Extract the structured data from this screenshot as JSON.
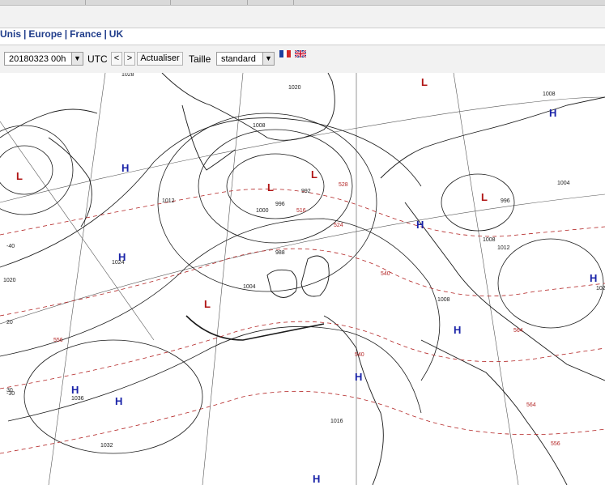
{
  "nav": {
    "links": [
      "Unis",
      "Europe",
      "France",
      "UK"
    ],
    "separator": "|"
  },
  "toolbar": {
    "date_value": "20180323 00h",
    "utc_label": "UTC",
    "prev_label": "<",
    "next_label": ">",
    "refresh_label": "Actualiser",
    "size_label": "Taille",
    "size_value": "standard"
  },
  "flags": [
    "french-flag",
    "uk-flag"
  ],
  "map": {
    "high_symbol": "H",
    "low_symbol": "L",
    "isobar_labels": [
      "1028",
      "1020",
      "1008",
      "1000",
      "996",
      "992",
      "988",
      "1012",
      "1004",
      "1020",
      "1032",
      "1024",
      "1036",
      "1016",
      "1008",
      "1008",
      "1004",
      "996",
      "1008",
      "1012",
      "1020"
    ],
    "thickness_labels": [
      "516",
      "524",
      "528",
      "540",
      "556",
      "564",
      "564",
      "556",
      "540"
    ],
    "temperature_labels": [
      "-40",
      "-30",
      "20",
      "30"
    ],
    "colors": {
      "coastline": "#1a1a1a",
      "isobar": "#1a1a1a",
      "thickness": "#b32424",
      "high": "#1a23a8",
      "low": "#b01515",
      "nav_link": "#1f3c8a"
    }
  }
}
